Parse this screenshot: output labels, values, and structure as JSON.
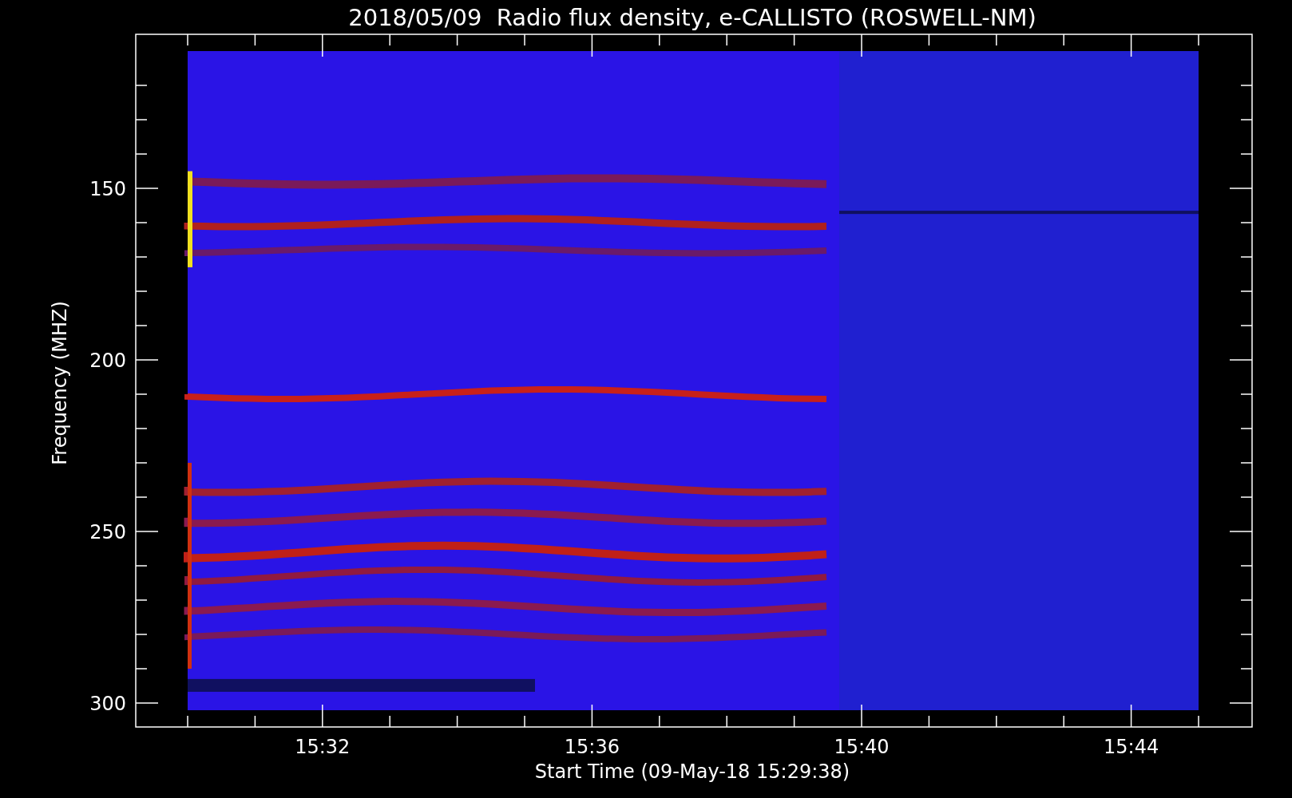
{
  "title": "2018/05/09  Radio flux density, e-CALLISTO (ROSWELL-NM)",
  "y_axis": {
    "label": "Frequency (MHZ)",
    "ticks": [
      "150",
      "200",
      "250",
      "300"
    ]
  },
  "x_axis": {
    "label": "Start Time (09-May-18 15:29:38)",
    "ticks": [
      "15:32",
      "15:36",
      "15:40",
      "15:44"
    ]
  }
}
